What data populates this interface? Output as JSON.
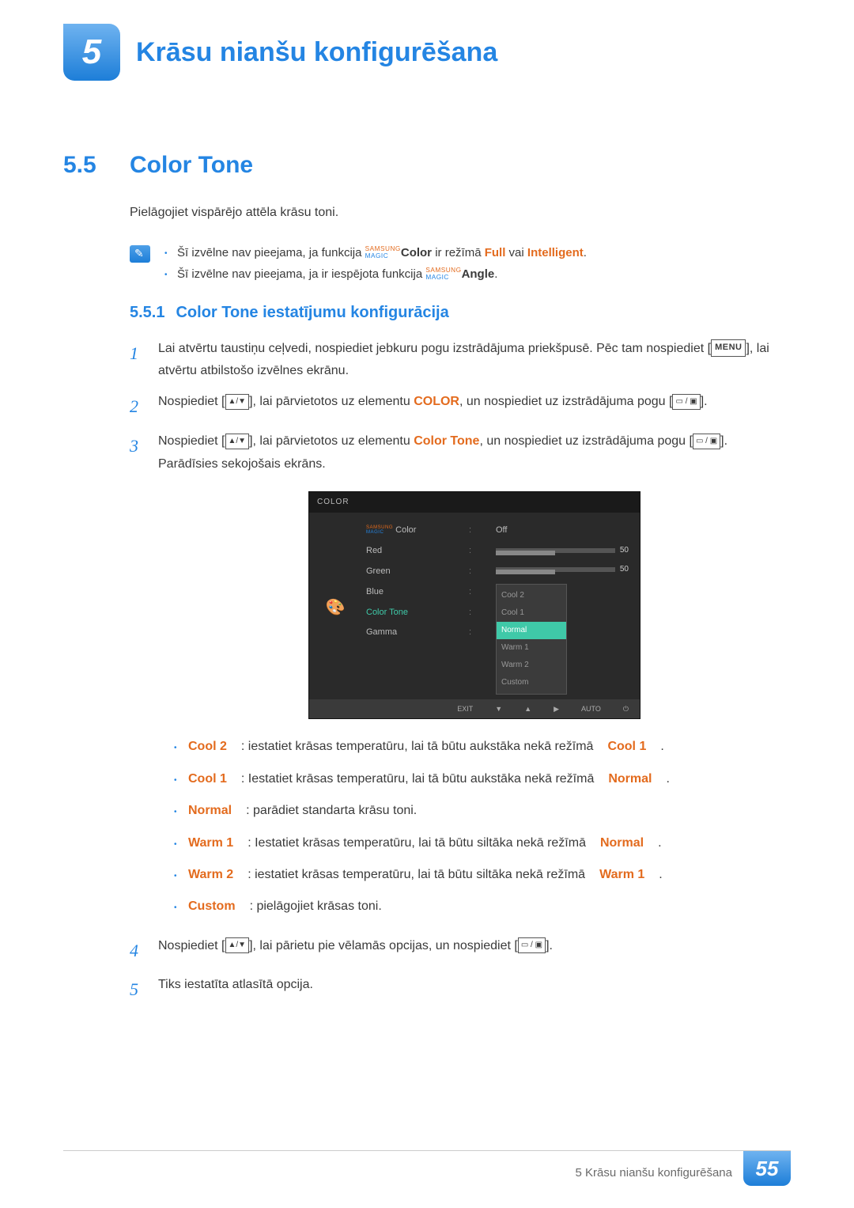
{
  "chapter": {
    "number": "5",
    "title": "Krāsu nianšu konfigurēšana"
  },
  "section": {
    "number": "5.5",
    "title": "Color Tone",
    "intro": "Pielāgojiet vispārējo attēla krāsu toni."
  },
  "magic": {
    "samsung": "SAMSUNG",
    "magic": "MAGIC"
  },
  "notes": {
    "n1a": "Šī izvēlne nav pieejama, ja funkcija ",
    "n1b": "Color",
    "n1c": " ir režīmā ",
    "n1d": "Full",
    "n1e": " vai ",
    "n1f": "Intelligent",
    "n1g": ".",
    "n2a": "Šī izvēlne nav pieejama, ja ir iespējota funkcija ",
    "n2b": "Angle",
    "n2c": "."
  },
  "subsection": {
    "number": "5.5.1",
    "title": "Color Tone iestatījumu konfigurācija"
  },
  "steps": {
    "s1a": "Lai atvērtu taustiņu ceļvedi, nospiediet jebkuru pogu izstrādājuma priekšpusē. Pēc tam nospiediet [",
    "menu": "MENU",
    "s1b": "], lai atvērtu atbilstošo izvēlnes ekrānu.",
    "s2a": "Nospiediet [",
    "s2b": "], lai pārvietotos uz elementu ",
    "s2c": "COLOR",
    "s2d": ", un nospiediet uz izstrādājuma pogu [",
    "s2e": "].",
    "s3a": "Nospiediet [",
    "s3b": "], lai pārvietotos uz elementu ",
    "s3c": "Color Tone",
    "s3d": ", un nospiediet uz izstrādājuma pogu [",
    "s3e": "]. Parādīsies sekojošais ekrāns.",
    "s4a": "Nospiediet [",
    "s4b": "], lai pārietu pie vēlamās opcijas, un nospiediet [",
    "s4c": "].",
    "s5": "Tiks iestatīta atlasītā opcija."
  },
  "osd": {
    "title": "COLOR",
    "items": {
      "magicColor": "Color",
      "red": "Red",
      "green": "Green",
      "blue": "Blue",
      "colorTone": "Color Tone",
      "gamma": "Gamma"
    },
    "values": {
      "off": "Off",
      "red": "50",
      "green": "50"
    },
    "dropdown": {
      "cool2": "Cool 2",
      "cool1": "Cool 1",
      "normal": "Normal",
      "warm1": "Warm 1",
      "warm2": "Warm 2",
      "custom": "Custom"
    },
    "nav": {
      "exit": "EXIT",
      "auto": "AUTO"
    }
  },
  "optionDesc": {
    "cool2_k": "Cool 2",
    "cool2_v": ": iestatiet krāsas temperatūru, lai tā būtu aukstāka nekā režīmā ",
    "cool2_r": "Cool 1",
    "dot": ".",
    "cool1_k": "Cool 1",
    "cool1_v": ": Iestatiet krāsas temperatūru, lai tā būtu aukstāka nekā režīmā ",
    "cool1_r": "Normal",
    "normal_k": "Normal",
    "normal_v": ": parādiet standarta krāsu toni.",
    "warm1_k": "Warm 1",
    "warm1_v": ": Iestatiet krāsas temperatūru, lai tā būtu siltāka nekā režīmā ",
    "warm1_r": "Normal",
    "warm2_k": "Warm 2",
    "warm2_v": ": iestatiet krāsas temperatūru, lai tā būtu siltāka nekā režīmā ",
    "warm2_r": "Warm 1",
    "custom_k": "Custom",
    "custom_v": ": pielāgojiet krāsas toni."
  },
  "footer": {
    "text": "5 Krāsu nianšu konfigurēšana",
    "page": "55"
  },
  "glyphs": {
    "updown": "▲/▼",
    "enter": "▭ / ▣"
  }
}
